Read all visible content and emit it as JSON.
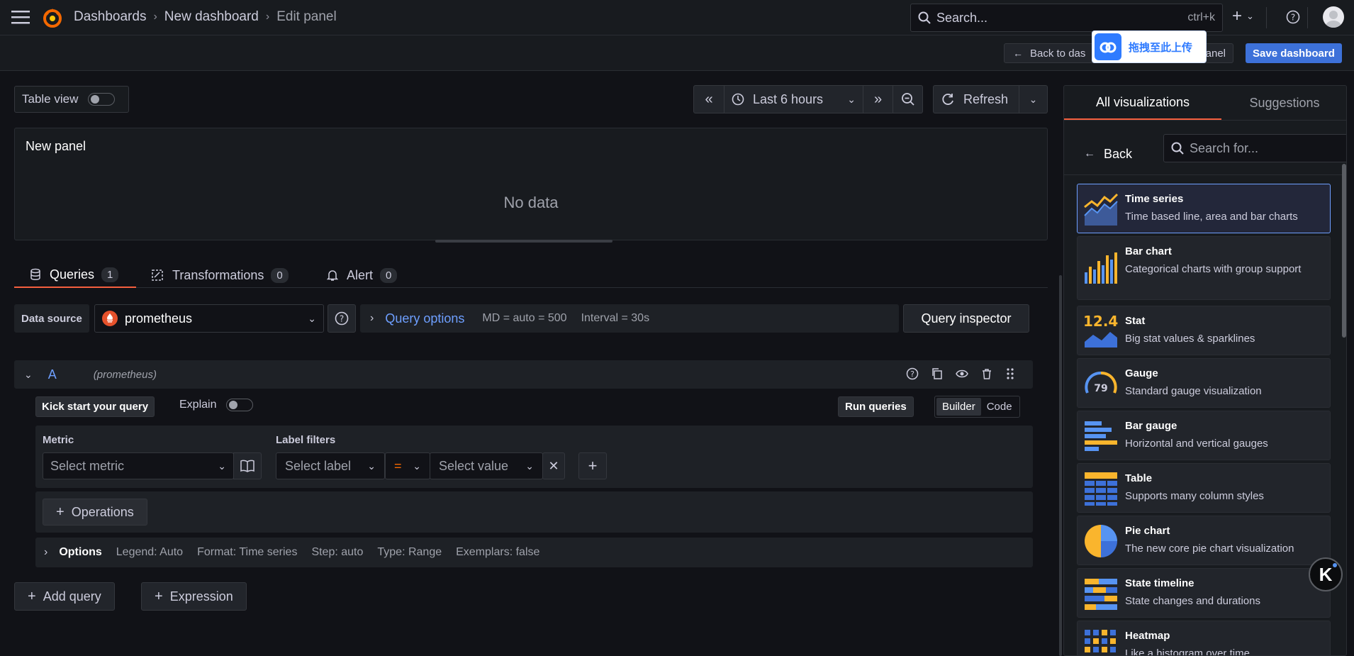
{
  "topbar": {
    "breadcrumbs": [
      "Dashboards",
      "New dashboard",
      "Edit panel"
    ],
    "search_placeholder": "Search...",
    "search_shortcut": "ctrl+k"
  },
  "subbar": {
    "back_label": "Back to das",
    "upload_overlay": "拖拽至此上传",
    "partial_label": "anel",
    "save_label": "Save dashboard"
  },
  "toolbar": {
    "table_view_label": "Table view",
    "time_range": "Last 6 hours",
    "refresh_label": "Refresh"
  },
  "preview": {
    "title": "New panel",
    "empty_text": "No data"
  },
  "tabs": [
    {
      "label": "Queries",
      "count": "1"
    },
    {
      "label": "Transformations",
      "count": "0"
    },
    {
      "label": "Alert",
      "count": "0"
    }
  ],
  "datasource": {
    "label": "Data source",
    "value": "prometheus",
    "query_options": "Query options",
    "md": "MD = auto = 500",
    "interval": "Interval = 30s",
    "inspector": "Query inspector"
  },
  "query": {
    "ref": "A",
    "source": "(prometheus)",
    "kick_start": "Kick start your query",
    "explain": "Explain",
    "run": "Run queries",
    "mode_builder": "Builder",
    "mode_code": "Code",
    "metric_label": "Metric",
    "metric_placeholder": "Select metric",
    "label_filters": "Label filters",
    "label_placeholder": "Select label",
    "operator": "=",
    "value_placeholder": "Select value",
    "operations": "Operations",
    "options_label": "Options",
    "options_summary": [
      "Legend: Auto",
      "Format: Time series",
      "Step: auto",
      "Type: Range",
      "Exemplars: false"
    ]
  },
  "bottom": {
    "add_query": "Add query",
    "expression": "Expression"
  },
  "viz": {
    "tab_all": "All visualizations",
    "tab_suggestions": "Suggestions",
    "back": "Back",
    "search_placeholder": "Search for...",
    "items": [
      {
        "name": "Time series",
        "desc": "Time based line, area and bar charts",
        "icon": "time-series-icon"
      },
      {
        "name": "Bar chart",
        "desc": "Categorical charts with group support",
        "icon": "bar-chart-icon"
      },
      {
        "name": "Stat",
        "desc": "Big stat values & sparklines",
        "icon": "stat-icon",
        "icon_text": "12.4"
      },
      {
        "name": "Gauge",
        "desc": "Standard gauge visualization",
        "icon": "gauge-icon",
        "icon_text": "79"
      },
      {
        "name": "Bar gauge",
        "desc": "Horizontal and vertical gauges",
        "icon": "bar-gauge-icon"
      },
      {
        "name": "Table",
        "desc": "Supports many column styles",
        "icon": "table-icon"
      },
      {
        "name": "Pie chart",
        "desc": "The new core pie chart visualization",
        "icon": "pie-chart-icon"
      },
      {
        "name": "State timeline",
        "desc": "State changes and durations",
        "icon": "state-timeline-icon"
      },
      {
        "name": "Heatmap",
        "desc": "Like a histogram over time",
        "icon": "heatmap-icon"
      }
    ]
  },
  "floating_button_letter": "K",
  "colors": {
    "accent_blue": "#6e9fff",
    "primary_button": "#3d71d9",
    "grafana_orange": "#f46800",
    "tab_underline": "#f55f3e",
    "viz_yellow": "#fab52d",
    "viz_blue": "#5794f2"
  }
}
